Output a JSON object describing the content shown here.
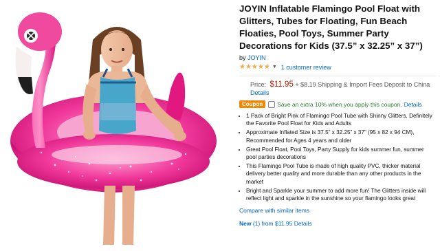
{
  "product": {
    "image_alt": "Girl holding a pink inflatable flamingo pool float",
    "title": "JOYIN Inflatable Flamingo Pool Float with Glitters, Tubes for Floating, Fun Beach Floaties, Pool Toys, Summer Party Decorations for Kids (37.5” x 32.25” x 37”)",
    "by_label": "by",
    "brand": "JOYIN",
    "rating": {
      "stars": "★★★★★",
      "chevron": "▼",
      "reviews_text": "1 customer review"
    },
    "price": {
      "label": "Price:",
      "value": "$11.95",
      "shipping": "+ $8.19 Shipping & Import Fees Deposit to China",
      "details_link": "Details"
    },
    "coupon": {
      "badge": "Coupon",
      "text": "Save an extra 10% when you apply this coupon.",
      "details": "Details"
    },
    "bullets": [
      "1 Pack of Bright Pink of Flamingo Pool Tube with Shinny Glitters, Definitely the Favorite Pool Float for Kids and Adults",
      "Approximate Inflated Size is 37.5” x 32.25” x 37” (95 x 82 x 94 CM), Recommended for Ages 4 years and older",
      "Great Pool Float, Pool Toys, Party Supply for kids summer fun, summer pool parties decorations",
      "This Flamingo Pool Tube is made of high quality PVC, thicker material delivery better quality and more durable than any other products in the market",
      "Bright and Sparkle your summer to add more fun! The Glitters inside will reflect light and sparkle in the sunshine so your flamingo looks great"
    ],
    "compare_link": "Compare with similar items",
    "new_label": "New",
    "new_offer": "(1) from $11.95",
    "new_details": "Details"
  },
  "colors": {
    "link": "#0066c0",
    "price": "#b12704",
    "star": "#f3a847",
    "coupon_badge": "#f08804",
    "flamingo_pink": "#e5178a"
  }
}
